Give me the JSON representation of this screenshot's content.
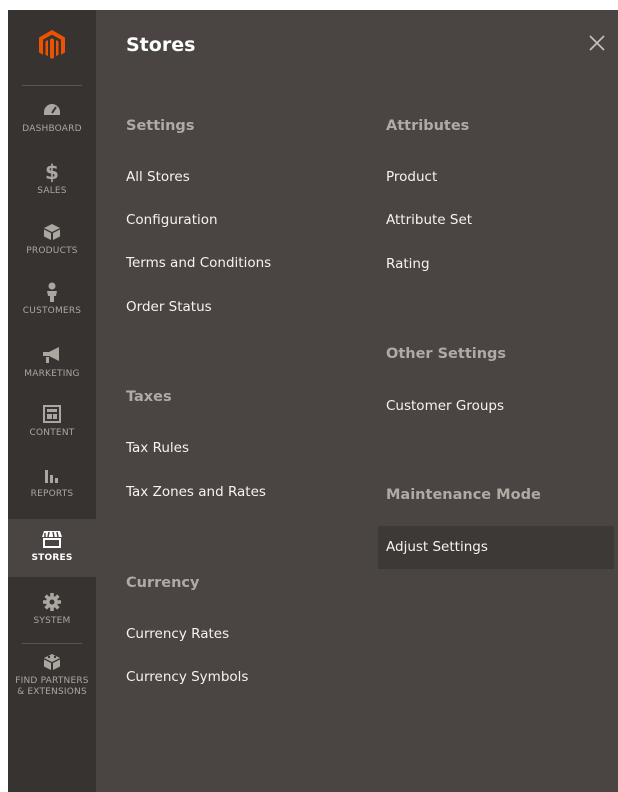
{
  "colors": {
    "sidebar_bg": "#373330",
    "panel_bg": "#4a4542",
    "accent_logo": "#eb5202",
    "active_item_bg": "#4a4542"
  },
  "sidebar": {
    "items": [
      {
        "label": "DASHBOARD",
        "icon": "dashboard-icon"
      },
      {
        "label": "SALES",
        "icon": "dollar-icon"
      },
      {
        "label": "PRODUCTS",
        "icon": "box-icon"
      },
      {
        "label": "CUSTOMERS",
        "icon": "person-icon"
      },
      {
        "label": "MARKETING",
        "icon": "megaphone-icon"
      },
      {
        "label": "CONTENT",
        "icon": "layout-icon"
      },
      {
        "label": "REPORTS",
        "icon": "bar-chart-icon"
      },
      {
        "label": "STORES",
        "icon": "storefront-icon",
        "active": true
      },
      {
        "label": "SYSTEM",
        "icon": "gear-icon"
      },
      {
        "label": "FIND PARTNERS\n& EXTENSIONS",
        "icon": "blocks-icon"
      }
    ],
    "find_partners_line1": "FIND PARTNERS",
    "find_partners_line2": "& EXTENSIONS"
  },
  "panel": {
    "title": "Stores",
    "close_icon": "close-icon",
    "left_groups": [
      {
        "title": "Settings",
        "links": [
          "All Stores",
          "Configuration",
          "Terms and Conditions",
          "Order Status"
        ]
      },
      {
        "title": "Taxes",
        "links": [
          "Tax Rules",
          "Tax Zones and Rates"
        ]
      },
      {
        "title": "Currency",
        "links": [
          "Currency Rates",
          "Currency Symbols"
        ]
      }
    ],
    "right_groups": [
      {
        "title": "Attributes",
        "links": [
          "Product",
          "Attribute Set",
          "Rating"
        ]
      },
      {
        "title": "Other Settings",
        "links": [
          "Customer Groups"
        ]
      },
      {
        "title": "Maintenance Mode",
        "links": [
          "Adjust Settings"
        ]
      }
    ]
  }
}
